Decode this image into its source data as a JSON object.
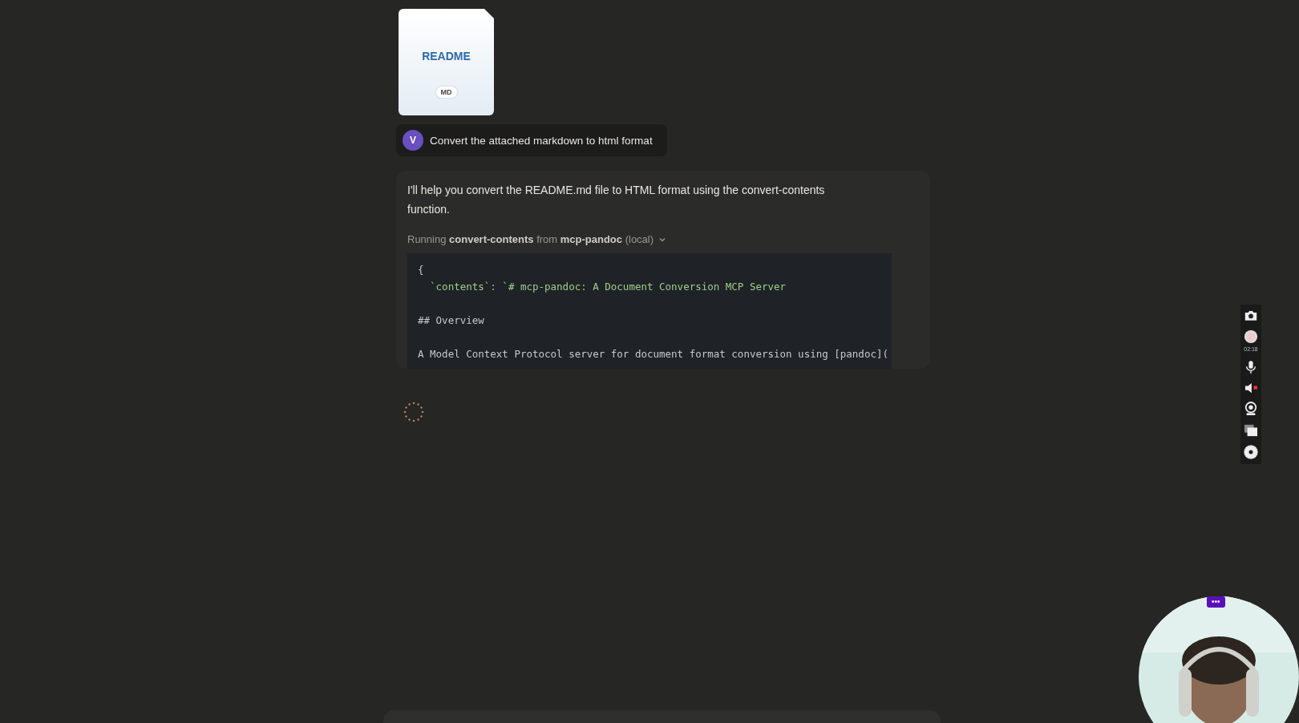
{
  "attachment": {
    "name": "README",
    "type": "MD"
  },
  "user_message": {
    "avatar": "V",
    "text": "Convert the attached markdown to html format"
  },
  "assistant": {
    "text": "I'll help you convert the README.md file to HTML format using the convert-contents function.",
    "tool_status": "Running **convert-contents** from **mcp-pandoc** (local)",
    "expanded": false,
    "code": "{\n  `contents`: `# mcp-pandoc: A Document Conversion MCP Server\n\n## Overview\n\nA Model Context Protocol server for document format conversion using [pandoc](",
    "loading": true
  },
  "recorder_toolbar": {
    "timer": "02:18"
  },
  "webcam": {
    "kind": "picture",
    "menu": "•••"
  }
}
